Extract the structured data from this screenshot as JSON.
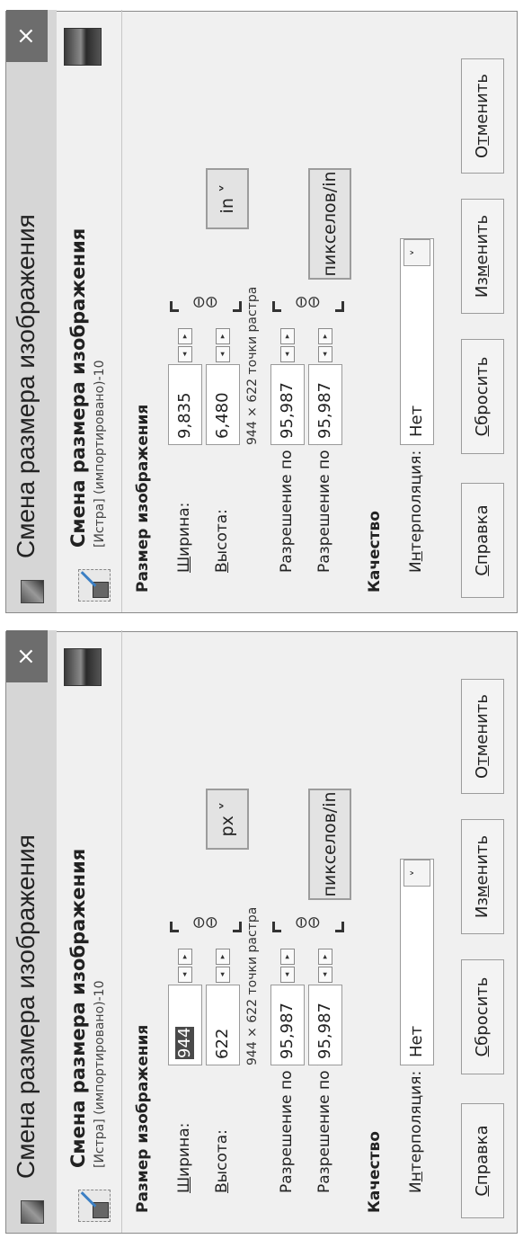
{
  "dialogs": [
    {
      "window_title": "Смена размера изображения",
      "close_glyph": "×",
      "header_title": "Смена размера изображения",
      "header_subtitle": "[Истра] (импортировано)-10",
      "size_section": "Размер изображения",
      "width_label": {
        "u": "Ш",
        "rest": "ирина:"
      },
      "width_value": "944",
      "height_label": {
        "u": "В",
        "rest": "ысота:"
      },
      "height_value": "622",
      "raster_info": "944 × 622 точки растра",
      "size_unit": "px ˅",
      "res_x_label": "Разрешение по X:",
      "res_x_value": "95,987",
      "res_y_label": "Разрешение по Y:",
      "res_y_value": "95,987",
      "res_unit": "пикселов/in",
      "quality_section": "Качество",
      "interp_label": {
        "a": "И",
        "u": "н",
        "rest": "терполяция:"
      },
      "interp_value": "Нет",
      "buttons": [
        {
          "a": "",
          "u": "С",
          "rest": "правка"
        },
        {
          "a": "",
          "u": "С",
          "rest": "бросить"
        },
        {
          "a": "Из",
          "u": "м",
          "rest": "енить"
        },
        {
          "a": "О",
          "u": "т",
          "rest": "менить"
        }
      ]
    },
    {
      "window_title": "Смена размера изображения",
      "close_glyph": "×",
      "header_title": "Смена размера изображения",
      "header_subtitle": "[Истра] (импортировано)-10",
      "size_section": "Размер изображения",
      "width_label": {
        "u": "Ш",
        "rest": "ирина:"
      },
      "width_value": "9,835",
      "height_label": {
        "u": "В",
        "rest": "ысота:"
      },
      "height_value": "6,480",
      "raster_info": "944 × 622 точки растра",
      "size_unit": "in ˅",
      "res_x_label": "Разрешение по X:",
      "res_x_value": "95,987",
      "res_y_label": "Разрешение по Y:",
      "res_y_value": "95,987",
      "res_unit": "пикселов/in",
      "quality_section": "Качество",
      "interp_label": {
        "a": "И",
        "u": "н",
        "rest": "терполяция:"
      },
      "interp_value": "Нет",
      "buttons": [
        {
          "a": "",
          "u": "С",
          "rest": "правка"
        },
        {
          "a": "",
          "u": "С",
          "rest": "бросить"
        },
        {
          "a": "Из",
          "u": "м",
          "rest": "енить"
        },
        {
          "a": "О",
          "u": "т",
          "rest": "менить"
        }
      ]
    }
  ]
}
